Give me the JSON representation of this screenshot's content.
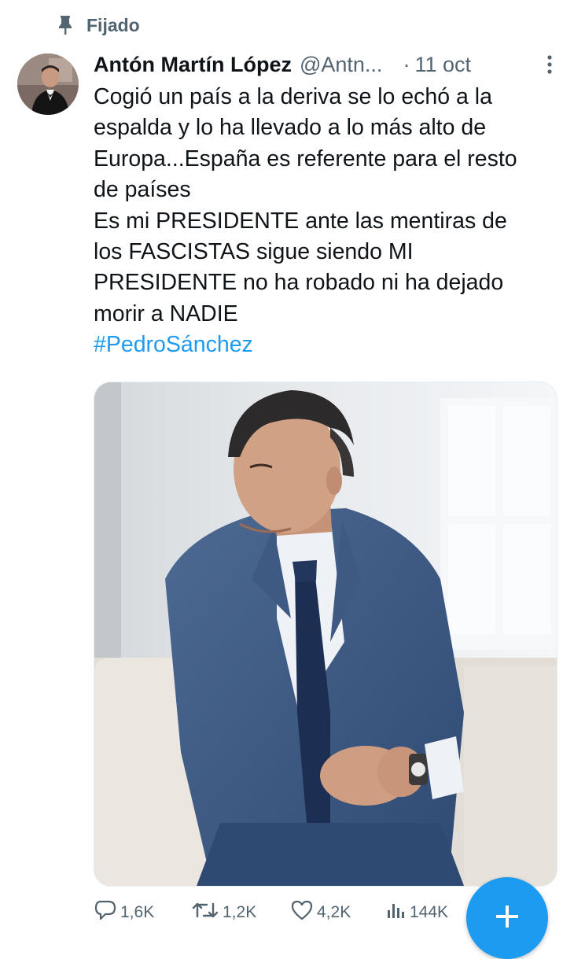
{
  "pinned": {
    "label": "Fijado",
    "icon": "pin-icon"
  },
  "tweet": {
    "author_name": "Antón Martín López",
    "author_handle": "@Antn...",
    "separator": "·",
    "date": "11 oct",
    "text_lines": [
      "Cogió un país a la deriva se lo echó a la",
      "espalda y lo ha llevado a lo más alto de",
      "Europa...España es referente para el resto",
      "de países",
      "Es mi PRESIDENTE ante las mentiras de",
      "los FASCISTAS sigue siendo MI",
      "PRESIDENTE no ha robado ni ha dejado",
      "morir a NADIE"
    ],
    "hashtag": "#PedroSánchez",
    "hashtag_color": "#1d9bf0"
  },
  "actions": {
    "replies": "1,6K",
    "retweets": "1,2K",
    "likes": "4,2K",
    "views": "144K"
  },
  "colors": {
    "accent": "#1d9bf0",
    "secondary_text": "#536471",
    "primary_text": "#0f1419"
  },
  "icons": {
    "pin": "pin-icon",
    "more": "more-vertical-icon",
    "reply": "reply-icon",
    "retweet": "retweet-icon",
    "like": "heart-icon",
    "views": "views-icon",
    "compose": "plus-icon"
  }
}
